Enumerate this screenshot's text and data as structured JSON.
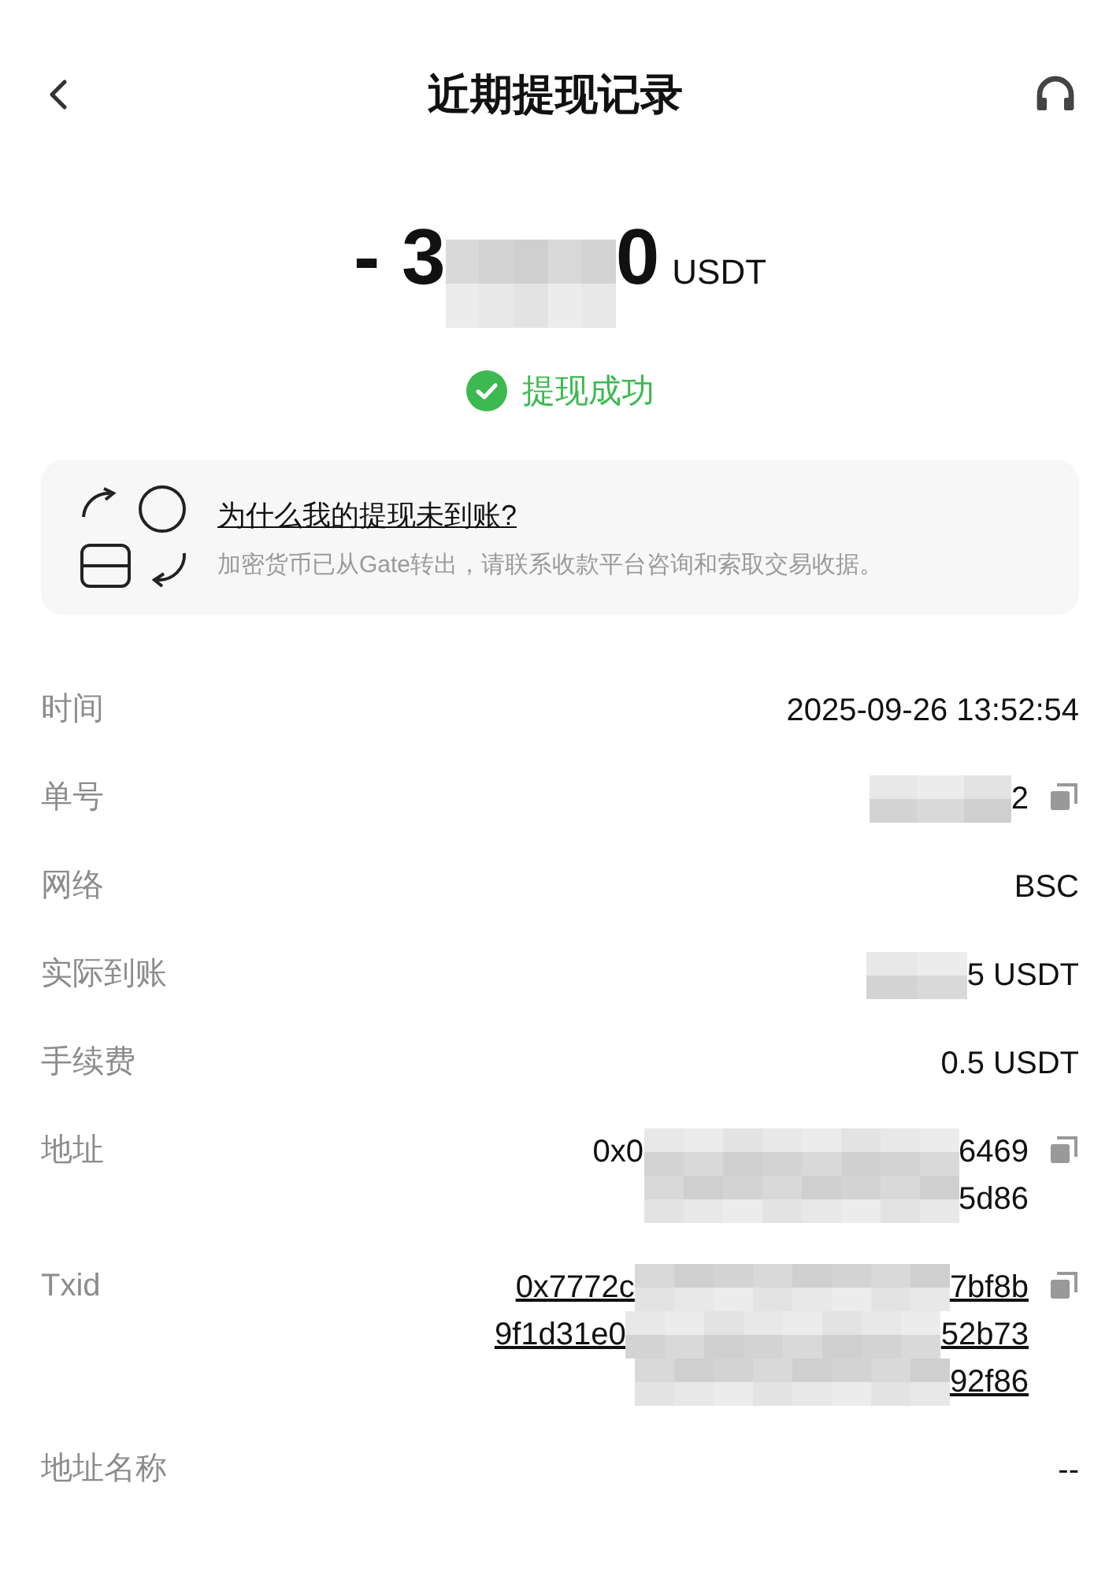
{
  "header": {
    "title": "近期提现记录"
  },
  "amount": {
    "before": "- 3",
    "after": "0",
    "unit": "USDT"
  },
  "status": {
    "text": "提现成功",
    "success": true
  },
  "notice": {
    "link": "为什么我的提现未到账?",
    "text": "加密货币已从Gate转出，请联系收款平台咨询和索取交易收据。"
  },
  "details": [
    {
      "label": "时间",
      "copy": false,
      "link": false,
      "lines": [
        {
          "before": "2025-09-26 13:52:54",
          "redacted": false
        }
      ]
    },
    {
      "label": "单号",
      "copy": true,
      "link": false,
      "lines": [
        {
          "redacted": true,
          "after": "2"
        }
      ]
    },
    {
      "label": "网络",
      "copy": false,
      "link": false,
      "lines": [
        {
          "before": "BSC",
          "redacted": false
        }
      ]
    },
    {
      "label": "实际到账",
      "copy": false,
      "link": false,
      "lines": [
        {
          "redacted": true,
          "after": "5 USDT"
        }
      ]
    },
    {
      "label": "手续费",
      "copy": false,
      "link": false,
      "lines": [
        {
          "before": "0.5 USDT",
          "redacted": false
        }
      ]
    },
    {
      "label": "地址",
      "copy": true,
      "link": false,
      "lines": [
        {
          "before": "0x0",
          "redacted": true,
          "after": "6469"
        },
        {
          "redacted": true,
          "after": "5d86"
        }
      ]
    },
    {
      "label": "Txid",
      "copy": true,
      "link": true,
      "lines": [
        {
          "before": "0x7772c",
          "redacted": true,
          "after": "7bf8b"
        },
        {
          "before": "9f1d31e0",
          "redacted": true,
          "after": "52b73"
        },
        {
          "redacted": true,
          "after": "92f86"
        }
      ]
    },
    {
      "label": "地址名称",
      "copy": false,
      "link": false,
      "lines": [
        {
          "before": "--",
          "redacted": false
        }
      ]
    }
  ]
}
